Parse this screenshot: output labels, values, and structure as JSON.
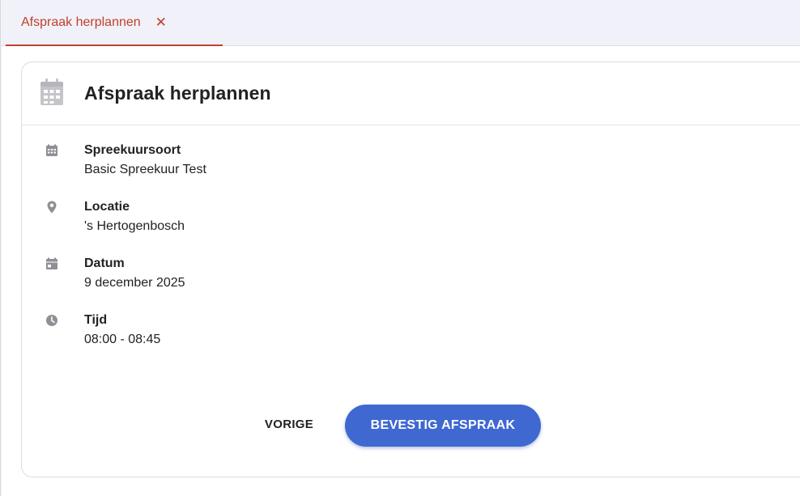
{
  "tab": {
    "label": "Afspraak herplannen",
    "close_icon": "close-icon"
  },
  "card": {
    "title": "Afspraak herplannen",
    "header_icon": "calendar-icon"
  },
  "details": [
    {
      "icon": "calendar-grid-icon",
      "label": "Spreekuursoort",
      "value": "Basic Spreekuur Test"
    },
    {
      "icon": "map-pin-icon",
      "label": "Locatie",
      "value": "'s Hertogenbosch"
    },
    {
      "icon": "calendar-day-icon",
      "label": "Datum",
      "value": "9 december 2025"
    },
    {
      "icon": "clock-icon",
      "label": "Tijd",
      "value": "08:00 - 08:45"
    }
  ],
  "actions": {
    "previous_label": "VORIGE",
    "confirm_label": "BEVESTIG AFSPRAAK"
  },
  "colors": {
    "accent": "#c0402a",
    "primary_button": "#3f68d1",
    "icon_gray": "#8f8f96"
  }
}
